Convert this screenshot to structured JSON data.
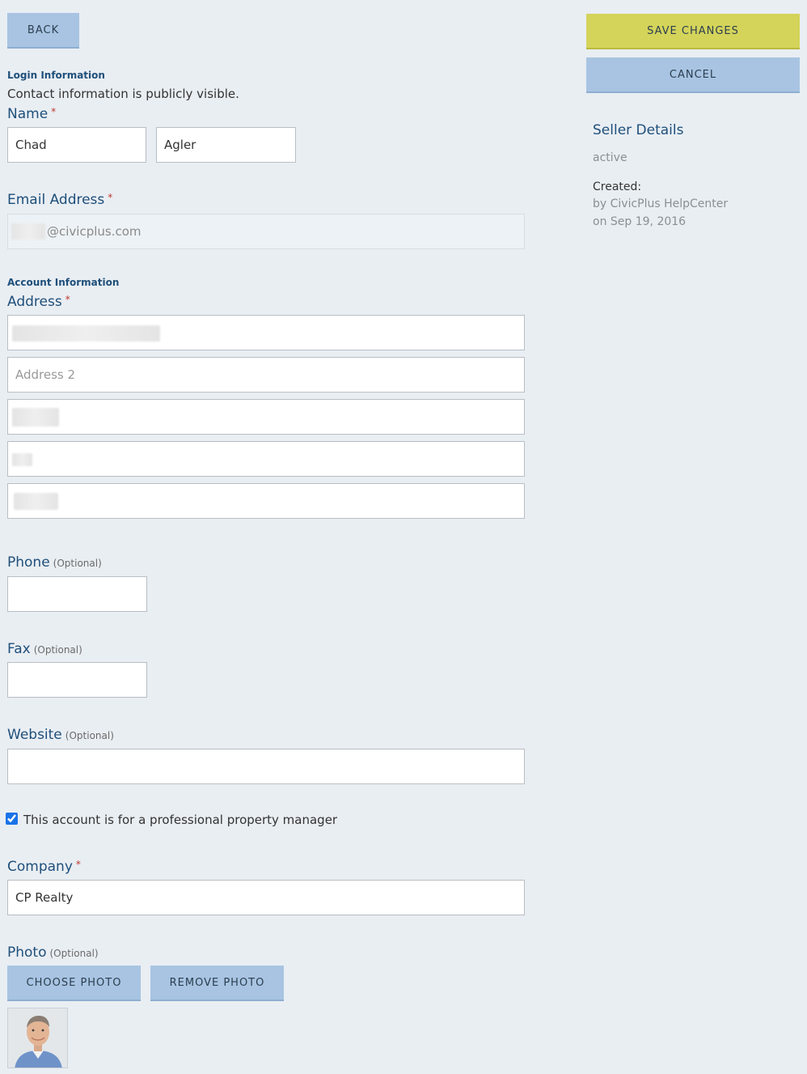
{
  "toolbar": {
    "back_label": "BACK",
    "save_label": "SAVE CHANGES",
    "cancel_label": "CANCEL"
  },
  "login_section": {
    "title": "Login Information",
    "note": "Contact information is publicly visible.",
    "name_label": "Name",
    "first_name": "Chad",
    "last_name": "Agler",
    "email_label": "Email Address",
    "email_domain": "@civicplus.com"
  },
  "account_section": {
    "title": "Account Information",
    "address_label": "Address",
    "address2_placeholder": "Address 2",
    "phone_label": "Phone",
    "fax_label": "Fax",
    "website_label": "Website",
    "optional_tag": "(Optional)",
    "property_manager_label": "This account is for a professional property manager",
    "property_manager_checked": true,
    "company_label": "Company",
    "company_value": "CP Realty",
    "photo_label": "Photo",
    "choose_photo_label": "CHOOSE PHOTO",
    "remove_photo_label": "REMOVE PHOTO"
  },
  "required_marker": "*",
  "seller_details": {
    "title": "Seller Details",
    "status": "active",
    "created_label": "Created:",
    "created_by": "by CivicPlus HelpCenter",
    "created_on": "on Sep 19, 2016"
  },
  "colors": {
    "background": "#e9eef3",
    "button": "#a8c4e2",
    "save_button": "#d4d45a",
    "label": "#1f4f7a",
    "required": "#c0392b"
  }
}
